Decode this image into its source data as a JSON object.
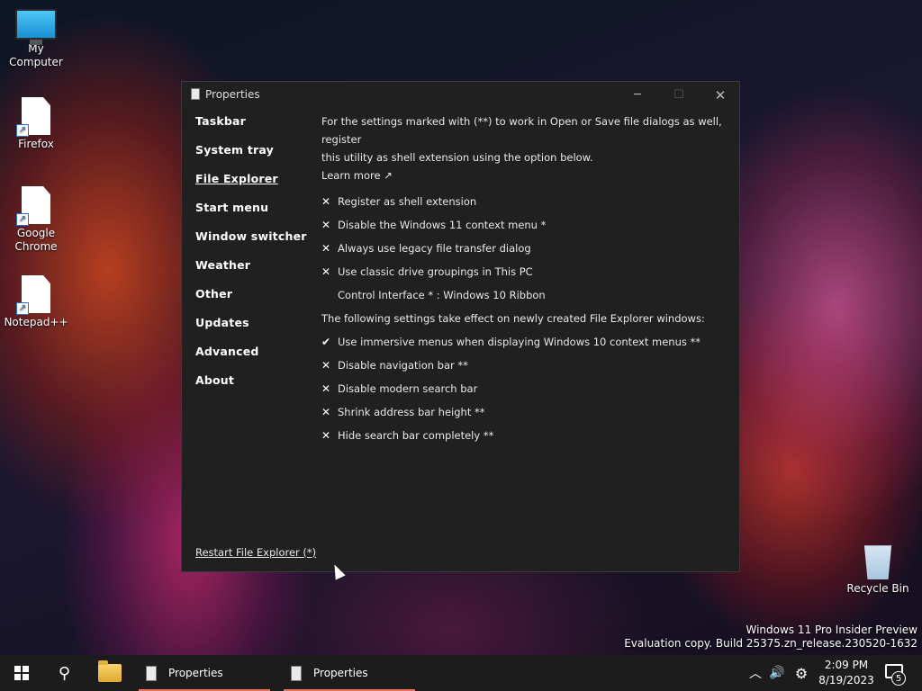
{
  "desktop": {
    "icons": [
      {
        "label": "My Computer"
      },
      {
        "label": "Firefox"
      },
      {
        "label": "Google Chrome"
      },
      {
        "label": "Notepad++"
      },
      {
        "label": "Recycle Bin"
      }
    ]
  },
  "window": {
    "title": "Properties",
    "controls": {
      "minimize": "─",
      "maximize": "☐",
      "close": "✕"
    },
    "nav": [
      {
        "label": "Taskbar"
      },
      {
        "label": "System tray"
      },
      {
        "label": "File Explorer",
        "active": true
      },
      {
        "label": "Start menu"
      },
      {
        "label": "Window switcher"
      },
      {
        "label": "Weather"
      },
      {
        "label": "Other"
      },
      {
        "label": "Updates"
      },
      {
        "label": "Advanced"
      },
      {
        "label": "About"
      }
    ],
    "intro_line1": "For the settings marked with (**) to work in Open or Save file dialogs as well, register",
    "intro_line2": "this utility as shell extension using the option below.",
    "learn_more": "Learn more ↗",
    "options_top": [
      {
        "mark": "✕",
        "label": "Register as shell extension"
      },
      {
        "mark": "✕",
        "label": "Disable the Windows 11 context menu *"
      },
      {
        "mark": "✕",
        "label": "Always use legacy file transfer dialog"
      },
      {
        "mark": "✕",
        "label": "Use classic drive groupings in This PC"
      }
    ],
    "control_interface": "Control Interface * : Windows 10 Ribbon",
    "section_note": "The following settings take effect on newly created File Explorer windows:",
    "options_bottom": [
      {
        "mark": "✔",
        "label": "Use immersive menus when displaying Windows 10 context menus **"
      },
      {
        "mark": "✕",
        "label": "Disable navigation bar **"
      },
      {
        "mark": "✕",
        "label": "Disable modern search bar"
      },
      {
        "mark": "✕",
        "label": "Shrink address bar height **"
      },
      {
        "mark": "✕",
        "label": "Hide search bar completely **"
      }
    ],
    "restart_link": "Restart File Explorer (*)"
  },
  "watermark": {
    "line1": "Windows 11 Pro Insider Preview",
    "line2": "Evaluation copy. Build 25375.zn_release.230520-1632"
  },
  "taskbar": {
    "items": [
      {
        "label": "Properties"
      },
      {
        "label": "Properties"
      }
    ],
    "tray": {
      "chevron": "︿",
      "volume": "🔊",
      "settings": "⚙"
    },
    "time": "2:09 PM",
    "date": "8/19/2023",
    "notification_count": "5"
  },
  "colors": {
    "window_bg": "#202020",
    "taskbar_bg": "#1c1c1c",
    "active_indicator": "#e8735a"
  }
}
